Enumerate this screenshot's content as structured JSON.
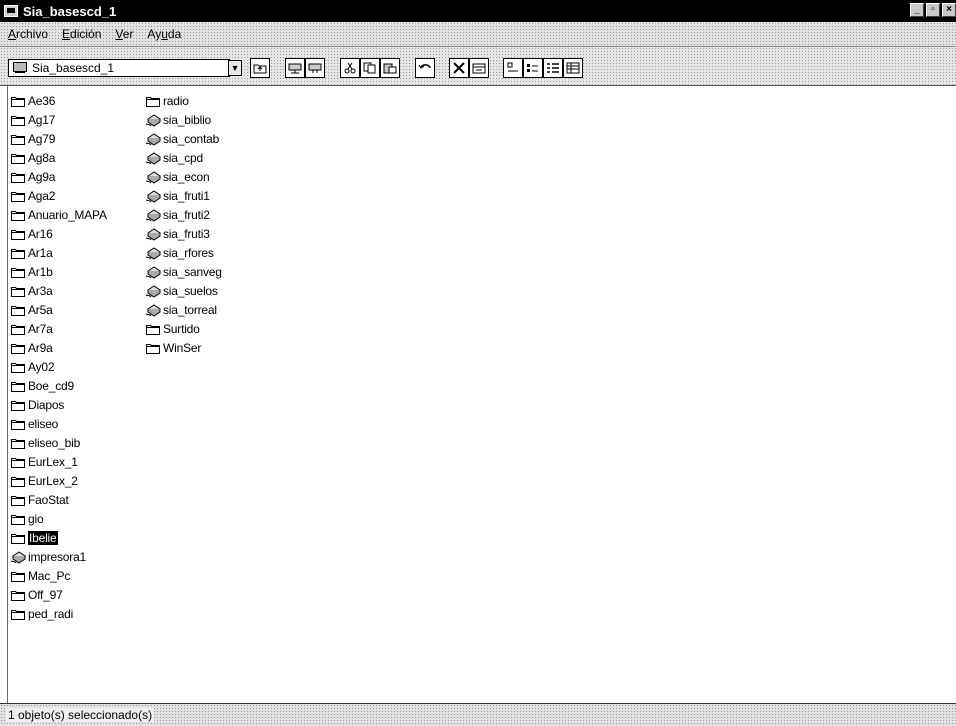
{
  "window": {
    "title": "Sia_basescd_1"
  },
  "menu": [
    {
      "pre": "",
      "u": "A",
      "post": "rchivo"
    },
    {
      "pre": "",
      "u": "E",
      "post": "dición"
    },
    {
      "pre": "",
      "u": "V",
      "post": "er"
    },
    {
      "pre": "Ay",
      "u": "u",
      "post": "da"
    }
  ],
  "address": {
    "value": "Sia_basescd_1"
  },
  "toolbar": [
    "up-folder",
    "map-drive",
    "disconnect-drive",
    "cut",
    "copy",
    "paste",
    "undo",
    "delete",
    "properties",
    "large-icons",
    "small-icons",
    "list",
    "details"
  ],
  "files": {
    "column1": [
      {
        "name": "Ae36",
        "icon": "folder"
      },
      {
        "name": "Ag17",
        "icon": "folder"
      },
      {
        "name": "Ag79",
        "icon": "folder"
      },
      {
        "name": "Ag8a",
        "icon": "folder"
      },
      {
        "name": "Ag9a",
        "icon": "folder"
      },
      {
        "name": "Aga2",
        "icon": "folder"
      },
      {
        "name": "Anuario_MAPA",
        "icon": "folder"
      },
      {
        "name": "Ar16",
        "icon": "folder"
      },
      {
        "name": "Ar1a",
        "icon": "folder"
      },
      {
        "name": "Ar1b",
        "icon": "folder"
      },
      {
        "name": "Ar3a",
        "icon": "folder"
      },
      {
        "name": "Ar5a",
        "icon": "folder"
      },
      {
        "name": "Ar7a",
        "icon": "folder"
      },
      {
        "name": "Ar9a",
        "icon": "folder"
      },
      {
        "name": "Ay02",
        "icon": "folder"
      },
      {
        "name": "Boe_cd9",
        "icon": "folder"
      },
      {
        "name": "Diapos",
        "icon": "folder"
      },
      {
        "name": "eliseo",
        "icon": "folder"
      },
      {
        "name": "eliseo_bib",
        "icon": "folder"
      },
      {
        "name": "EurLex_1",
        "icon": "folder"
      },
      {
        "name": "EurLex_2",
        "icon": "folder"
      },
      {
        "name": "FaoStat",
        "icon": "folder"
      },
      {
        "name": "gio",
        "icon": "folder"
      },
      {
        "name": "Ibelie",
        "icon": "folder",
        "selected": true
      },
      {
        "name": "impresora1",
        "icon": "printer"
      },
      {
        "name": "Mac_Pc",
        "icon": "folder"
      },
      {
        "name": "Off_97",
        "icon": "folder"
      },
      {
        "name": "ped_radi",
        "icon": "folder"
      }
    ],
    "column2": [
      {
        "name": "radio",
        "icon": "folder"
      },
      {
        "name": "sia_biblio",
        "icon": "printer"
      },
      {
        "name": "sia_contab",
        "icon": "printer"
      },
      {
        "name": "sia_cpd",
        "icon": "printer"
      },
      {
        "name": "sia_econ",
        "icon": "printer"
      },
      {
        "name": "sia_fruti1",
        "icon": "printer"
      },
      {
        "name": "sia_fruti2",
        "icon": "printer"
      },
      {
        "name": "sia_fruti3",
        "icon": "printer"
      },
      {
        "name": "sia_rfores",
        "icon": "printer"
      },
      {
        "name": "sia_sanveg",
        "icon": "printer"
      },
      {
        "name": "sia_suelos",
        "icon": "printer"
      },
      {
        "name": "sia_torreal",
        "icon": "printer"
      },
      {
        "name": "Surtido",
        "icon": "folder"
      },
      {
        "name": "WinSer",
        "icon": "folder"
      }
    ]
  },
  "status": {
    "text": "1 objeto(s) seleccionado(s)"
  }
}
